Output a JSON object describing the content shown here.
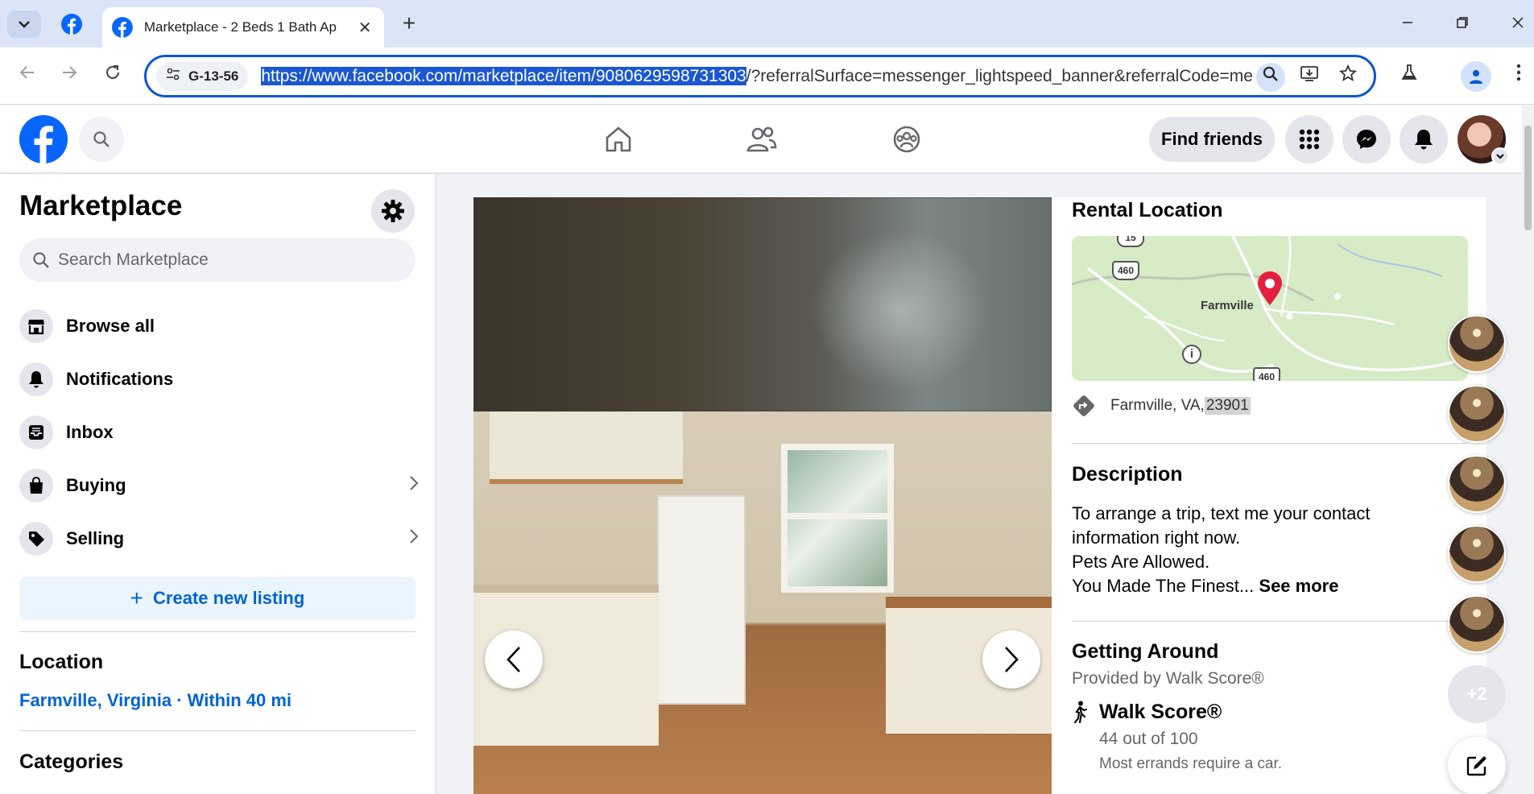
{
  "browser": {
    "active_tab_title": "Marketplace - 2 Beds 1 Bath Ap",
    "new_tab_symbol": "+",
    "close_tab_symbol": "✕",
    "site_info_label": "G-13-56",
    "url_selected": "https://www.facebook.com/marketplace/item/9080629598731303",
    "url_rest": "/?referralSurface=messenger_lightspeed_banner&referralCode=mes"
  },
  "fb_nav": {
    "find_friends_label": "Find friends"
  },
  "sidebar": {
    "title": "Marketplace",
    "search_placeholder": "Search Marketplace",
    "items": [
      {
        "label": "Browse all"
      },
      {
        "label": "Notifications"
      },
      {
        "label": "Inbox"
      },
      {
        "label": "Buying"
      },
      {
        "label": "Selling"
      }
    ],
    "create_label": "Create new listing",
    "location_heading": "Location",
    "location_value": "Farmville, Virginia · Within 40 mi",
    "categories_heading": "Categories"
  },
  "listing": {
    "rental_location_heading": "Rental Location",
    "map": {
      "city_label": "Farmville",
      "route_top": "460",
      "route_bottom": "460",
      "route_north": "15"
    },
    "address_text": "Farmville, VA, ",
    "address_zip": "23901",
    "description_heading": "Description",
    "description_lines": [
      "To arrange a trip, text me your contact",
      "information right now.",
      "Pets Are Allowed.",
      "You Made The Finest..."
    ],
    "see_more_label": "See more",
    "getting_around_heading": "Getting Around",
    "walk_provider": "Provided by Walk Score®",
    "walk_title": "Walk Score®",
    "walk_score_text": "44 out of 100",
    "walk_note": "Most errands require a car."
  },
  "chat": {
    "more_label": "+2"
  },
  "colors": {
    "fb_blue": "#0866ff",
    "link_blue": "#0064d1",
    "omnibox_border": "#0b57d0",
    "map_pin": "#e41e3f"
  }
}
